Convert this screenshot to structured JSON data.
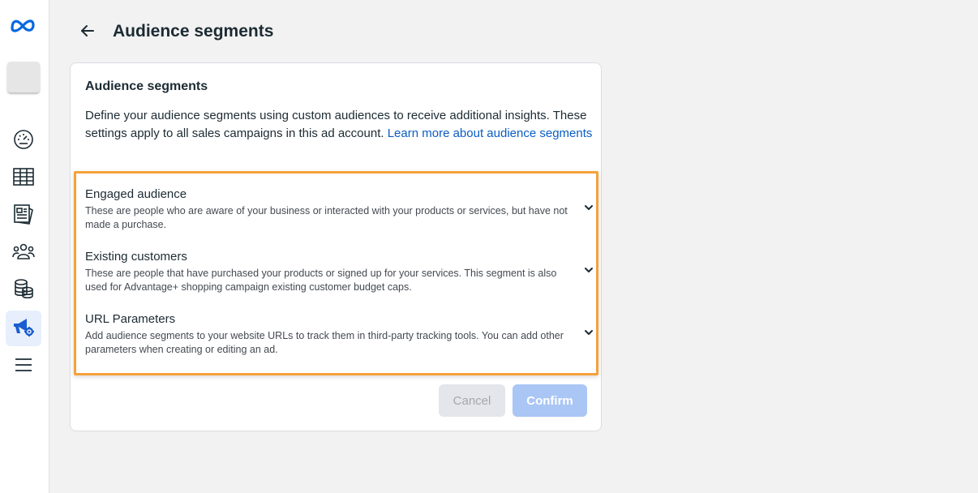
{
  "header": {
    "title": "Audience segments"
  },
  "card": {
    "title": "Audience segments",
    "description": "Define your audience segments using custom audiences to receive additional insights. These settings apply to all sales campaigns in this ad account.",
    "learn_more_link": "Learn more about audience segments"
  },
  "segments": [
    {
      "title": "Engaged audience",
      "description": "These are people who are aware of your business or interacted with your products or services, but have not made a purchase."
    },
    {
      "title": "Existing customers",
      "description": "These are people that have purchased your products or signed up for your services. This segment is also used for Advantage+ shopping campaign existing customer budget caps."
    },
    {
      "title": "URL Parameters",
      "description": "Add audience segments to your website URLs to track them in third-party tracking tools. You can add other parameters when creating or editing an ad."
    }
  ],
  "actions": {
    "cancel_label": "Cancel",
    "confirm_label": "Confirm"
  },
  "sidebar": {
    "items": [
      {
        "icon": "gauge-icon"
      },
      {
        "icon": "table-icon"
      },
      {
        "icon": "newspaper-icon"
      },
      {
        "icon": "people-icon"
      },
      {
        "icon": "database-icon"
      },
      {
        "icon": "megaphone-gear-icon",
        "active": true
      },
      {
        "icon": "hamburger-menu-icon"
      }
    ]
  },
  "colors": {
    "accent": "#0a5dc2",
    "highlight": "#f4a13b",
    "active_icon": "#1a5ecf"
  }
}
